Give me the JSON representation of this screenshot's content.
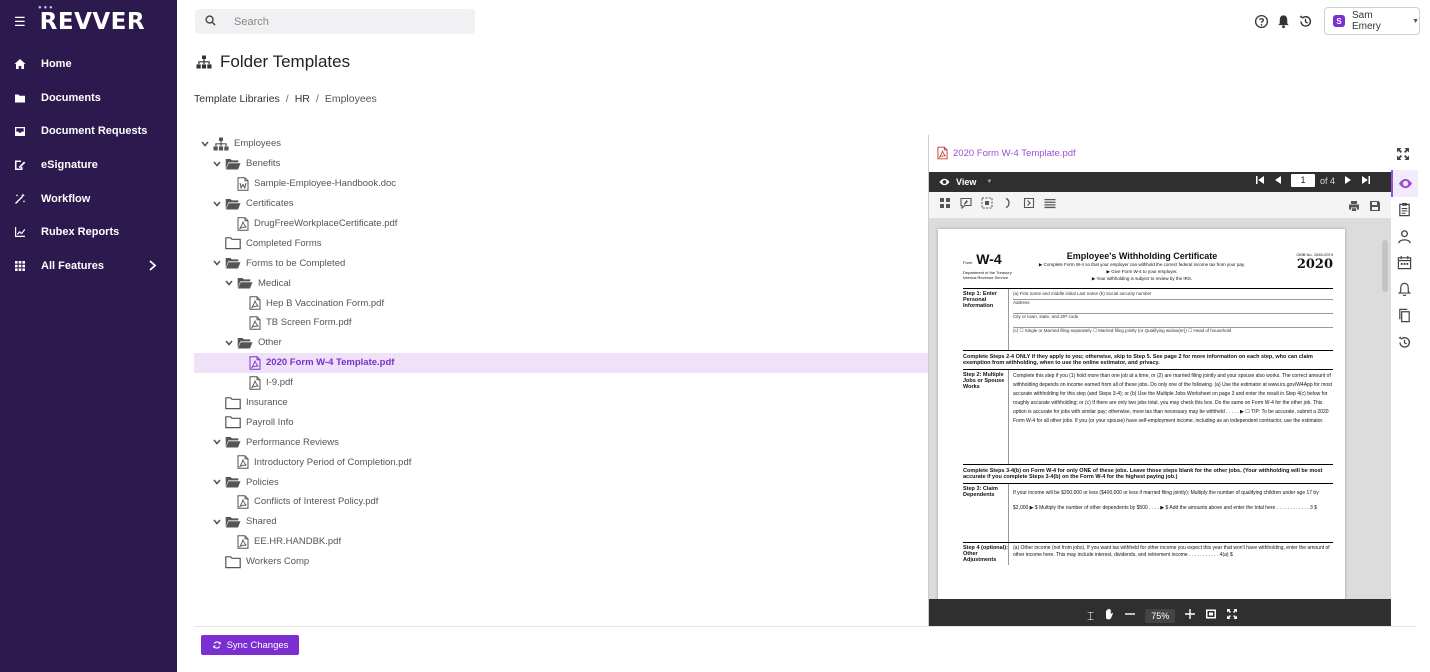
{
  "app": {
    "logo": "REVVER"
  },
  "sidebar": {
    "items": [
      {
        "label": "Home"
      },
      {
        "label": "Documents"
      },
      {
        "label": "Document Requests"
      },
      {
        "label": "eSignature"
      },
      {
        "label": "Workflow"
      },
      {
        "label": "Rubex Reports"
      },
      {
        "label": "All Features"
      }
    ]
  },
  "search": {
    "placeholder": "Search"
  },
  "user": {
    "initial": "S",
    "name": "Sam Emery"
  },
  "page": {
    "title": "Folder Templates"
  },
  "breadcrumb": {
    "items": [
      "Template Libraries",
      "HR",
      "Employees"
    ],
    "separator": "/"
  },
  "tree": {
    "rows": [
      {
        "label": "Employees"
      },
      {
        "label": "Benefits"
      },
      {
        "label": "Sample-Employee-Handbook.doc"
      },
      {
        "label": "Certificates"
      },
      {
        "label": "DrugFreeWorkplaceCertificate.pdf"
      },
      {
        "label": "Completed Forms"
      },
      {
        "label": "Forms to be Completed"
      },
      {
        "label": "Medical"
      },
      {
        "label": "Hep B Vaccination Form.pdf"
      },
      {
        "label": "TB Screen Form.pdf"
      },
      {
        "label": "Other"
      },
      {
        "label": "2020 Form W-4 Template.pdf"
      },
      {
        "label": "I-9.pdf"
      },
      {
        "label": "Insurance"
      },
      {
        "label": "Payroll Info"
      },
      {
        "label": "Performance Reviews"
      },
      {
        "label": "Introductory Period of Completion.pdf"
      },
      {
        "label": "Policies"
      },
      {
        "label": "Conflicts of Interest Policy.pdf"
      },
      {
        "label": "Shared"
      },
      {
        "label": "EE.HR.HANDBK.pdf"
      },
      {
        "label": "Workers Comp"
      }
    ]
  },
  "viewer": {
    "file_name": "2020 Form W-4 Template.pdf",
    "view_label": "View",
    "page_current": "1",
    "page_total_label": "of 4",
    "zoom": "75%",
    "doc": {
      "form_label": "Form",
      "form_name": "W-4",
      "dept": "Department of the Treasury Internal Revenue Service",
      "title": "Employee's Withholding Certificate",
      "sub1": "▶ Complete Form W-4 so that your employer can withhold the correct federal income tax from your pay.",
      "sub2": "▶ Give Form W-4 to your employer.",
      "sub3": "▶ Your withholding is subject to review by the IRS.",
      "omb": "OMB No. 1545-0074",
      "year": "2020",
      "step1_label": "Step 1: Enter Personal Information",
      "step1_line1": "(a) First name and middle initial          Last name                     (b) Social security number",
      "step1_line2": "Address",
      "step1_line3": "City or town, state, and ZIP code",
      "step1_line4": "(c)  ☐ Single or Married filing separately   ☐ Married filing jointly (or Qualifying widow(er))   ☐ Head of household",
      "para1": "Complete Steps 2-4 ONLY if they apply to you; otherwise, skip to Step 5. See page 2 for more information on each step, who can claim exemption from withholding, when to use the online estimator, and privacy.",
      "step2_label": "Step 2: Multiple Jobs or Spouse Works",
      "step2_body": "Complete this step if you (1) hold more than one job at a time, or (2) are married filing jointly and your spouse also works. The correct amount of withholding depends on income earned from all of these jobs. Do only one of the following. (a) Use the estimator at www.irs.gov/W4App for most accurate withholding for this step (and Steps 3-4); or (b) Use the Multiple Jobs Worksheet on page 3 and enter the result in Step 4(c) below for roughly accurate withholding; or (c) If there are only two jobs total, you may check this box. Do the same on Form W-4 for the other job. This option is accurate for jobs with similar pay; otherwise, more tax than necessary may be withheld . . . . . ▶ ☐  TIP: To be accurate, submit a 2020 Form W-4 for all other jobs. If you (or your spouse) have self-employment income, including as an independent contractor, use the estimator.",
      "para2": "Complete Steps 3-4(b) on Form W-4 for only ONE of these jobs. Leave those steps blank for the other jobs. (Your withholding will be most accurate if you complete Steps 3-4(b) on the Form W-4 for the highest paying job.)",
      "step3_label": "Step 3: Claim Dependents",
      "step3_body": "If your income will be $200,000 or less ($400,000 or less if married filing jointly): Multiply the number of qualifying children under age 17 by $2,000 ▶ $        Multiply the number of other dependents by $500 . . . . ▶ $        Add the amounts above and enter the total here . . . . . . . . . . . .  3  $",
      "step4_label": "Step 4 (optional): Other Adjustments",
      "step4_body": "(a) Other income (not from jobs). If you want tax withheld for other income you expect this year that won't have withholding, enter the amount of other income here. This may include interest, dividends, and retirement income . . . . . . . . . . . 4(a) $"
    }
  },
  "footer": {
    "sync_label": "Sync Changes"
  },
  "colors": {
    "sidebar": "#2c1a4e",
    "accent": "#7b2fd1",
    "selected_bg": "#efe2f8"
  }
}
